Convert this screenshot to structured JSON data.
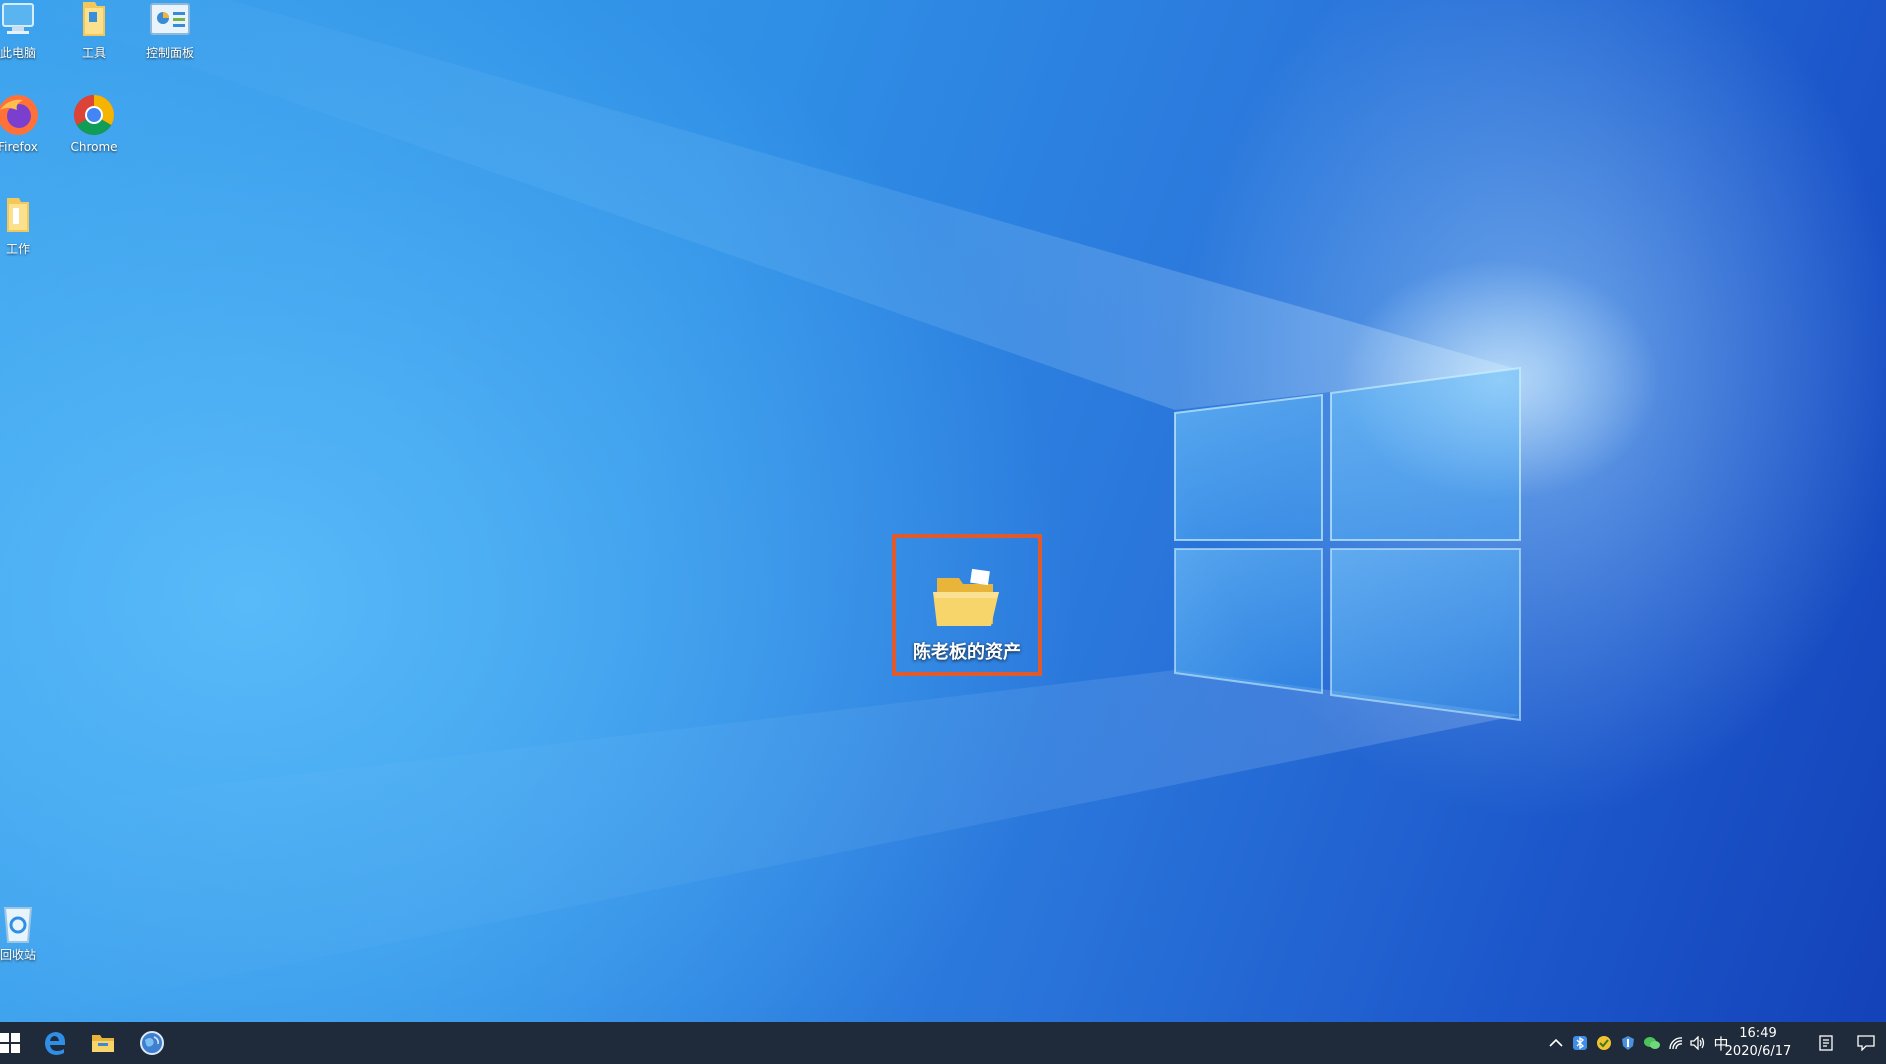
{
  "desktop": {
    "icons": [
      {
        "label": "此电脑",
        "icon": "this-pc-icon"
      },
      {
        "label": "工具",
        "icon": "folder-icon"
      },
      {
        "label": "控制面板",
        "icon": "control-panel-icon"
      },
      {
        "label": "Firefox",
        "icon": "firefox-icon"
      },
      {
        "label": "Chrome",
        "icon": "chrome-icon"
      },
      {
        "label": "工作",
        "icon": "folder-icon"
      },
      {
        "label": "回收站",
        "icon": "recycle-bin-icon"
      }
    ],
    "selected_folder": {
      "label": "陈老板的资产",
      "icon": "folder-icon",
      "highlight_color": "#e15a2e"
    }
  },
  "taskbar": {
    "pinned": [
      {
        "icon": "windows-start-icon"
      },
      {
        "icon": "edge-browser-icon"
      },
      {
        "icon": "file-explorer-icon"
      },
      {
        "icon": "globe-browser-icon"
      }
    ],
    "tray": {
      "ime": "中",
      "time": "16:49",
      "date": "2020/6/17"
    }
  },
  "colors": {
    "taskbar_bg": "#1f2b3a",
    "desktop_blue": "#2f8fe6",
    "highlight": "#e15a2e"
  }
}
